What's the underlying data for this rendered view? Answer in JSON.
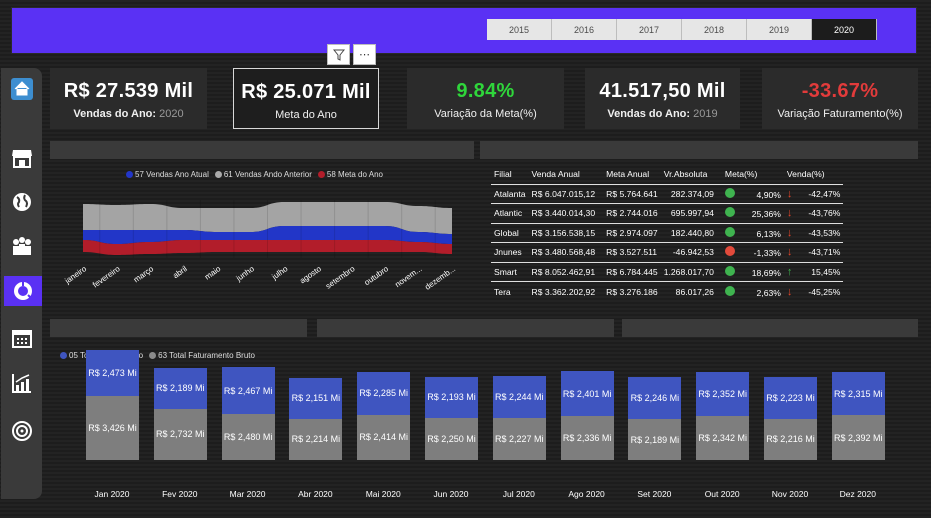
{
  "years": [
    "2015",
    "2016",
    "2017",
    "2018",
    "2019",
    "2020"
  ],
  "selected_year": "2020",
  "header_icons": [
    "filter-icon",
    "more-options-icon"
  ],
  "sidebar": [
    "home-icon",
    "store-icon",
    "globe-icon",
    "people-icon",
    "donut-chart-icon",
    "calendar-icon",
    "bar-chart-icon",
    "target-icon"
  ],
  "kpis": {
    "vendas": {
      "value": "R$ 27.539 Mil",
      "label": "Vendas do Ano:",
      "year": "2020"
    },
    "meta": {
      "value": "R$ 25.071 Mil",
      "label": "Meta do Ano"
    },
    "variacao_meta": {
      "value": "9.84%",
      "label": "Variação da Meta(%)",
      "color": "#2fd63b"
    },
    "vendas_prev": {
      "value": "41.517,50 Mil",
      "label": "Vendas do Ano:",
      "year": "2019"
    },
    "variacao_fat": {
      "value": "-33.67%",
      "label": "Variação Faturamento(%)",
      "color": "#e23b3b"
    }
  },
  "ribbon_legend": [
    {
      "label": "57 Vendas Ano Atual",
      "color": "#2236c8"
    },
    {
      "label": "61 Vendas Ando Anterior",
      "color": "#a9a9a9"
    },
    {
      "label": "58 Meta do Ano",
      "color": "#b21d2a"
    }
  ],
  "ribbon_months": [
    "janeiro",
    "fevereiro",
    "março",
    "abril",
    "maio",
    "junho",
    "julho",
    "agosto",
    "setembro",
    "outubro",
    "novem...",
    "dezemb..."
  ],
  "table": {
    "headers": [
      "Filial",
      "Venda Anual",
      "Meta Anual",
      "Vr.Absoluta",
      "Meta(%)",
      "Venda(%)"
    ],
    "rows": [
      {
        "filial": "Atalanta",
        "venda": "R$ 6.047.015,12",
        "meta": "R$ 5.764.641",
        "abs": "282.374,09",
        "meta_pct": "4,90%",
        "meta_status": "#3fb34f",
        "venda_pct": "-42,47%",
        "arrow": "↓",
        "arrow_color": "#e5462a"
      },
      {
        "filial": "Atlantic",
        "venda": "R$ 3.440.014,30",
        "meta": "R$ 2.744.016",
        "abs": "695.997,94",
        "meta_pct": "25,36%",
        "meta_status": "#3fb34f",
        "venda_pct": "-43,76%",
        "arrow": "↓",
        "arrow_color": "#e5462a"
      },
      {
        "filial": "Global",
        "venda": "R$ 3.156.538,15",
        "meta": "R$ 2.974.097",
        "abs": "182.440,80",
        "meta_pct": "6,13%",
        "meta_status": "#3fb34f",
        "venda_pct": "-43,53%",
        "arrow": "↓",
        "arrow_color": "#e5462a"
      },
      {
        "filial": "Jnunes",
        "venda": "R$ 3.480.568,48",
        "meta": "R$ 3.527.511",
        "abs": "-46.942,53",
        "meta_pct": "-1,33%",
        "meta_status": "#e24a3b",
        "venda_pct": "-43,71%",
        "arrow": "↓",
        "arrow_color": "#e5462a"
      },
      {
        "filial": "Smart",
        "venda": "R$ 8.052.462,91",
        "meta": "R$ 6.784.445",
        "abs": "1.268.017,70",
        "meta_pct": "18,69%",
        "meta_status": "#3fb34f",
        "venda_pct": "15,45%",
        "arrow": "↑",
        "arrow_color": "#3fb34f"
      },
      {
        "filial": "Tera",
        "venda": "R$ 3.362.202,92",
        "meta": "R$ 3.276.186",
        "abs": "86.017,26",
        "meta_pct": "2,63%",
        "meta_status": "#3fb34f",
        "venda_pct": "-45,25%",
        "arrow": "↓",
        "arrow_color": "#e5462a"
      }
    ]
  },
  "bar_legend": [
    {
      "label": "05 Total Venda Bruto",
      "color": "#3f55c0"
    },
    {
      "label": "63 Total Faturamento Bruto",
      "color": "#8a8a8a"
    }
  ],
  "chart_data": {
    "type": "bar",
    "categories": [
      "Jan 2020",
      "Fev 2020",
      "Mar 2020",
      "Abr 2020",
      "Mai 2020",
      "Jun 2020",
      "Jul 2020",
      "Ago 2020",
      "Set 2020",
      "Out 2020",
      "Nov 2020",
      "Dez 2020"
    ],
    "series": [
      {
        "name": "05 Total Venda Bruto",
        "values": [
          2.473,
          2.189,
          2.467,
          2.151,
          2.285,
          2.193,
          2.244,
          2.401,
          2.246,
          2.352,
          2.223,
          2.315
        ],
        "labels": [
          "R$ 2,473 Mi",
          "R$ 2,189 Mi",
          "R$ 2,467 Mi",
          "R$ 2,151 Mi",
          "R$ 2,285 Mi",
          "R$ 2,193 Mi",
          "R$ 2,244 Mi",
          "R$ 2,401 Mi",
          "R$ 2,246 Mi",
          "R$ 2,352 Mi",
          "R$ 2,223 Mi",
          "R$ 2,315 Mi"
        ]
      },
      {
        "name": "63 Total Faturamento Bruto",
        "values": [
          3.426,
          2.732,
          2.48,
          2.214,
          2.414,
          2.25,
          2.227,
          2.336,
          2.189,
          2.342,
          2.216,
          2.392
        ],
        "labels": [
          "R$ 3,426 Mi",
          "R$ 2,732 Mi",
          "R$ 2,480 Mi",
          "R$ 2,214 Mi",
          "R$ 2,414 Mi",
          "R$ 2,250 Mi",
          "R$ 2,227 Mi",
          "R$ 2,336 Mi",
          "R$ 2,189 Mi",
          "R$ 2,342 Mi",
          "R$ 2,216 Mi",
          "R$ 2,392 Mi"
        ]
      }
    ],
    "stacked": true,
    "legend": "top-left"
  }
}
